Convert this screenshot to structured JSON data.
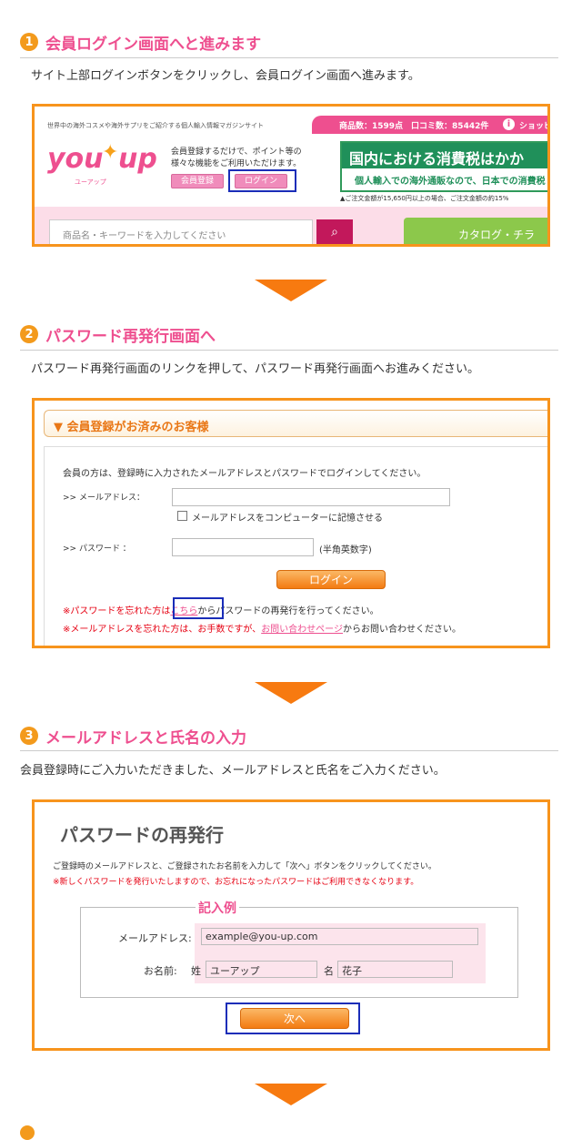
{
  "step1": {
    "num": "1",
    "title": "会員ログイン画面へと進みます",
    "desc": "サイト上部ログインボタンをクリックし、会員ログイン画面へ進みます。",
    "site": {
      "tagline": "世界中の海外コスメや海外サプリをご紹介する個人輸入情報マガジンサイト",
      "logo_main": "you",
      "logo_up": "up",
      "logo_sub": "ユーアップ",
      "stats": "商品数：1599点　口コミ数：85442件",
      "shop_link": "ショッピ",
      "member_text1": "会員登録するだけで、ポイント等の",
      "member_text2": "様々な機能をご利用いただけます。",
      "register_label": "会員登録",
      "login_label": "ログイン",
      "banner_title": "国内における消費税はかか",
      "banner_sub": "個人輸入での海外通販なので、日本での消費税",
      "banner_note": "▲ご注文金額が15,650円以上の場合、ご注文金額の約15%",
      "search_placeholder": "商品名・キーワードを入力してください",
      "catalog_label": "カタログ・チラ"
    }
  },
  "step2": {
    "num": "2",
    "title": "パスワード再発行画面へ",
    "desc": "パスワード再発行画面のリンクを押して、パスワード再発行画面へお進みください。",
    "panel_title": "▼ 会員登録がお済みのお客様",
    "intro": "会員の方は、登録時に入力されたメールアドレスとパスワードでログインしてください。",
    "email_label": ">> メールアドレス：",
    "remember_label": "メールアドレスをコンピューターに記憶させる",
    "password_label": ">> パスワード ：",
    "password_hint": "(半角英数字)",
    "login_button": "ログイン",
    "forgot_pre": "※パスワードを忘れた方は",
    "forgot_link": "こちら",
    "forgot_post": "からパスワードの再発行を行ってください。",
    "forgot_mail_pre": "※メールアドレスを忘れた方は、お手数ですが、",
    "forgot_mail_link": "お問い合わせページ",
    "forgot_mail_post": "からお問い合わせください。"
  },
  "step3": {
    "num": "3",
    "title": "メールアドレスと氏名の入力",
    "desc": "会員登録時にご入力いただきました、メールアドレスと氏名をご入力ください。",
    "page_title": "パスワードの再発行",
    "instruction": "ご登録時のメールアドレスと、ご登録されたお名前を入力して「次へ」ボタンをクリックしてください。",
    "warning": "※新しくパスワードを発行いたしますので、お忘れになったパスワードはご利用できなくなります。",
    "example_label": "記入例",
    "email_label": "メールアドレス:",
    "email_value": "example@you-up.com",
    "name_label": "お名前:",
    "last_label": "姓",
    "last_value": "ユーアップ",
    "first_label": "名",
    "first_value": "花子",
    "next_button": "次へ"
  },
  "colors": {
    "accent": "#f7941d",
    "pink": "#ee4f8f",
    "blue_highlight": "#1a2db8",
    "arrow": "#f77a10"
  }
}
